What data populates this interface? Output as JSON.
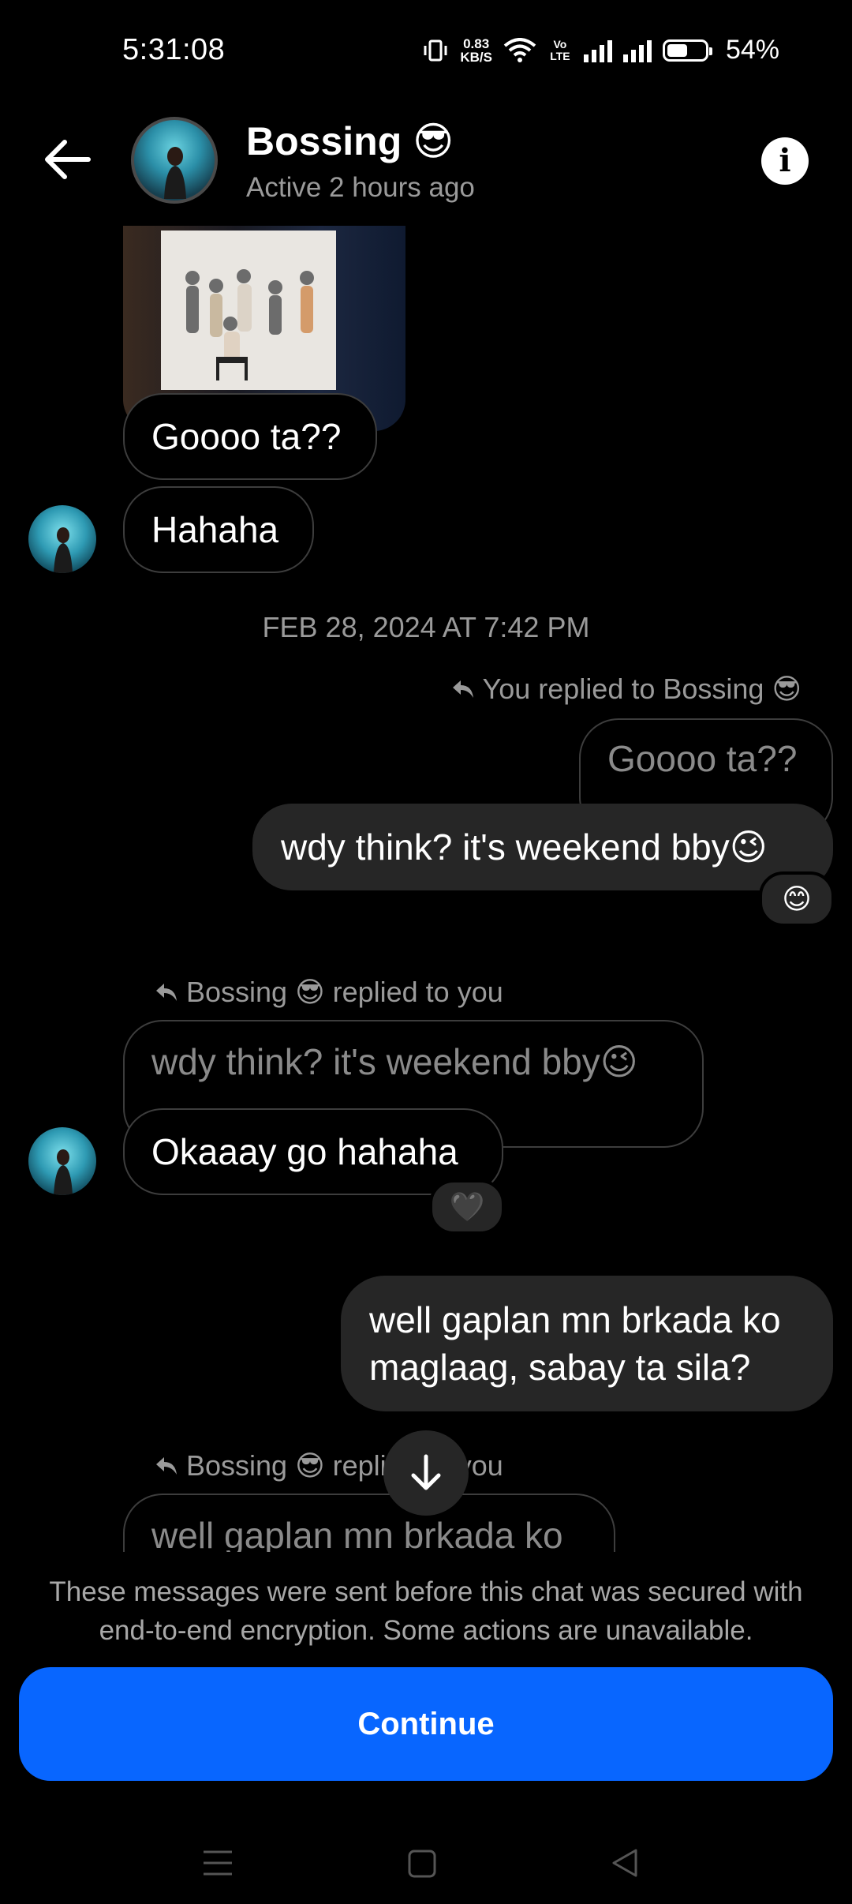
{
  "status_bar": {
    "time": "5:31:08",
    "net_speed_value": "0.83",
    "net_speed_unit": "KB/S",
    "volte": "Vo LTE",
    "battery_percent": "54%",
    "battery_level": 0.54
  },
  "header": {
    "contact_name": "Bossing 😎",
    "contact_status": "Active 2 hours ago"
  },
  "messages": [
    {
      "id": "m1",
      "text": "Goooo ta??",
      "direction": "incoming"
    },
    {
      "id": "m2",
      "text": "Hahaha",
      "direction": "incoming"
    },
    {
      "id": "sep",
      "text": "FEB 28, 2024 AT 7:42 PM"
    },
    {
      "id": "m3_reply_label",
      "text": "You replied to Bossing 😎"
    },
    {
      "id": "m3_quoted",
      "text": "Goooo ta??"
    },
    {
      "id": "m3",
      "text": "wdy think? it's weekend bby😉",
      "reaction": "😊"
    },
    {
      "id": "m4_reply_label",
      "text": "Bossing 😎 replied to you"
    },
    {
      "id": "m4_quoted",
      "text": "wdy think? it's weekend bby😉"
    },
    {
      "id": "m4",
      "text": "Okaaay go hahaha",
      "reaction": "🖤"
    },
    {
      "id": "m5",
      "text": "well gaplan mn brkada ko maglaag, sabay ta sila?"
    },
    {
      "id": "m6_reply_label",
      "text": "Bossing 😎 replied to you"
    },
    {
      "id": "m6_quoted",
      "text": "well gaplan mn brkada ko"
    }
  ],
  "footer": {
    "notice": "These messages were sent before this chat was secured with end-to-end encryption. Some actions are unavailable.",
    "continue_label": "Continue"
  },
  "icons": {
    "back": "arrow-left-icon",
    "info": "info-icon",
    "reply": "reply-arrow-icon",
    "scroll_down": "arrow-down-icon",
    "nav_menu": "menu-icon",
    "nav_home": "square-home-icon",
    "nav_back": "triangle-back-icon"
  },
  "colors": {
    "accent": "#0866ff",
    "bubble_out": "#262626",
    "bubble_border": "#3d3d3d",
    "muted_text": "#9a9a9a"
  }
}
